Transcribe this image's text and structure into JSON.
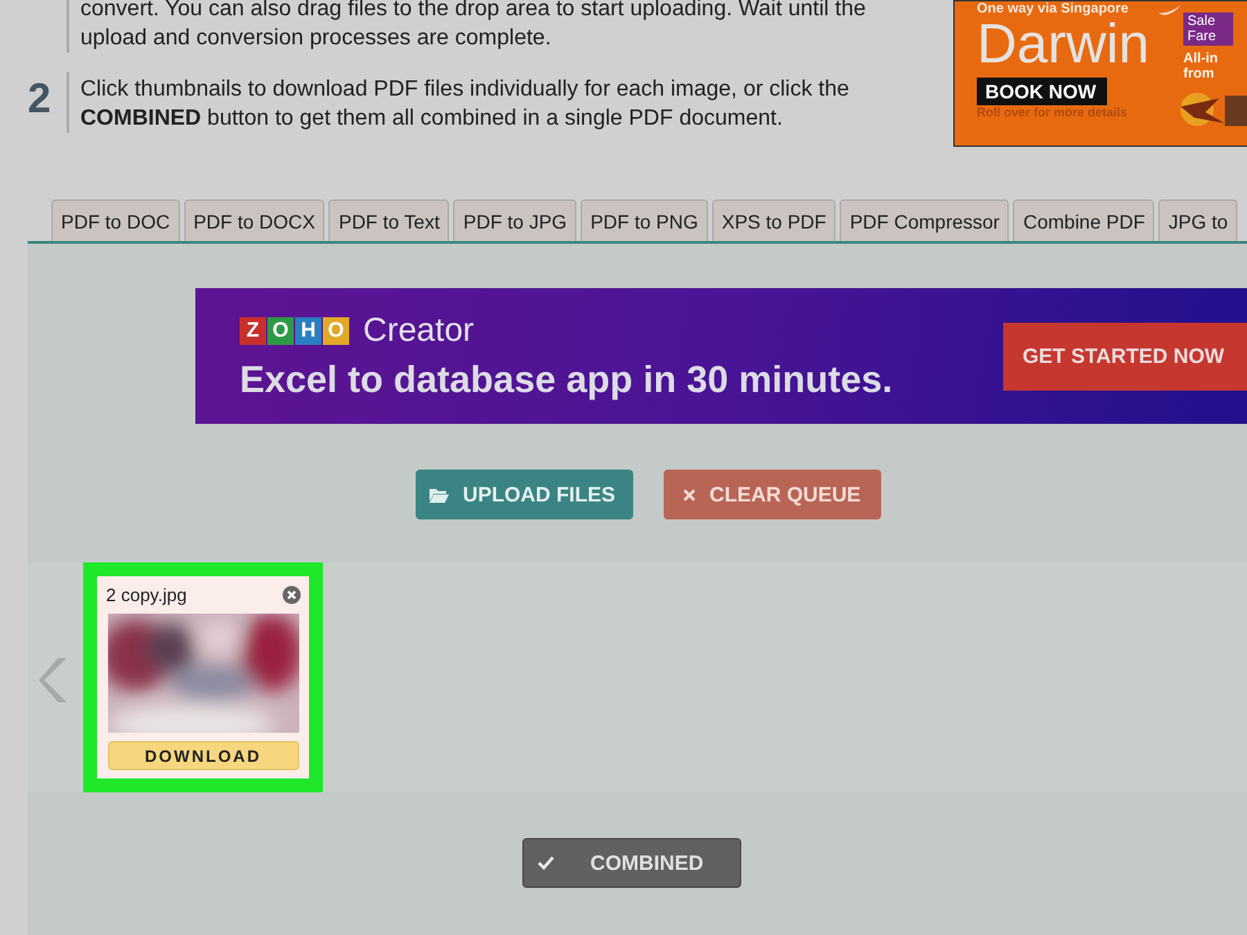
{
  "steps": [
    {
      "lines": [
        "convert. You can also drag files to the drop area to start uploading. Wait until the",
        "upload and conversion processes are complete."
      ]
    },
    {
      "number": "2",
      "lines": [
        "Click thumbnails to download PDF files individually for each image, or click the",
        "**COMBINED** button to get them all combined in a single PDF document."
      ]
    }
  ],
  "top_ad": {
    "tagline": "One way via Singapore",
    "city": "Darwin",
    "button": "BOOK NOW",
    "note": "Roll over for more details",
    "badge": [
      "Sale",
      "Fare"
    ],
    "side": [
      "All-in",
      "from"
    ]
  },
  "tabs": [
    "PDF to DOC",
    "PDF to DOCX",
    "PDF to Text",
    "PDF to JPG",
    "PDF to PNG",
    "XPS to PDF",
    "PDF Compressor",
    "Combine PDF",
    "JPG to"
  ],
  "banner_ad": {
    "logo_letters": [
      "Z",
      "O",
      "H",
      "O"
    ],
    "product": "Creator",
    "headline": "Excel to database app in 30 minutes.",
    "button": "GET STARTED NOW"
  },
  "actions": [
    {
      "kind": "upload",
      "label": "UPLOAD FILES"
    },
    {
      "kind": "clear",
      "label": "CLEAR QUEUE"
    }
  ],
  "files": [
    {
      "name": "2 copy.jpg",
      "button": "DOWNLOAD",
      "selected": true
    }
  ],
  "combined_button": "COMBINED"
}
